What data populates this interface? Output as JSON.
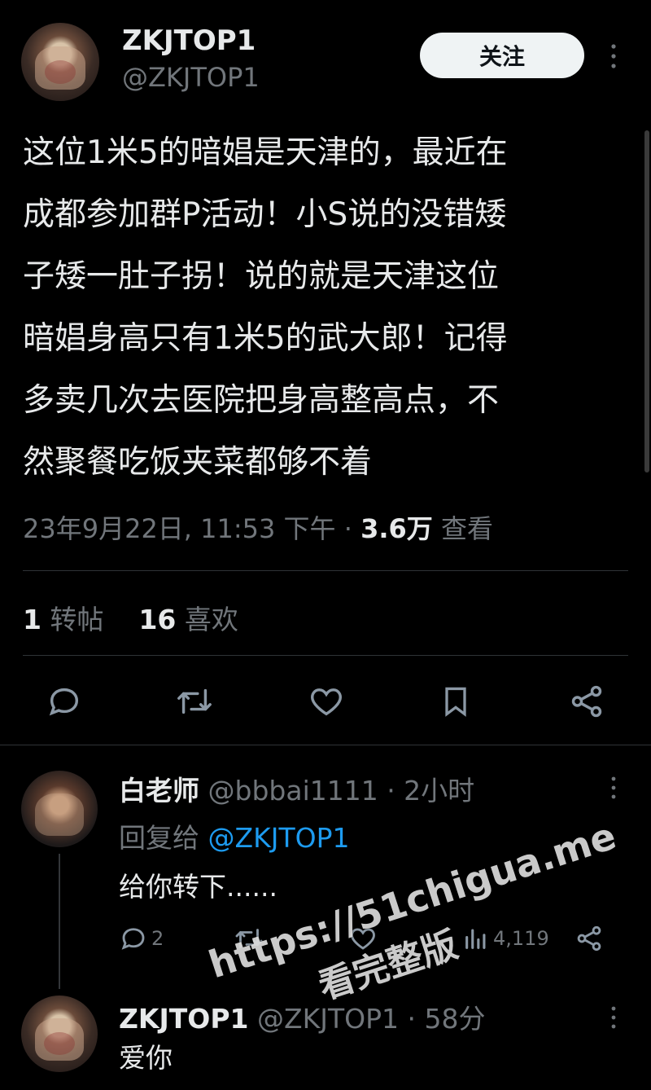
{
  "tweet": {
    "display_name": "ZKJTOP1",
    "handle": "@ZKJTOP1",
    "follow_label": "关注",
    "body_lines": [
      "这位1米5的暗娼是天津的，最近在",
      "成都参加群P活动！小S说的没错矮",
      "子矮一肚子拐！说的就是天津这位",
      "暗娼身高只有1米5的武大郎！记得",
      "多卖几次去医院把身高整高点，不",
      "然聚餐吃饭夹菜都够不着"
    ],
    "timestamp": "23年9月22日, 11:53 下午 · ",
    "views_count": "3.6万",
    "views_label": " 查看",
    "retweets_count": "1",
    "retweets_label": "转帖",
    "likes_count": "16",
    "likes_label": "喜欢"
  },
  "reply1": {
    "display_name": "白老师",
    "meta": "@bbbai1111 · 2小时",
    "replying_prefix": "回复给 ",
    "replying_to": "@ZKJTOP1",
    "text": "给你转下......",
    "reply_count": "2",
    "views_count": "4,119"
  },
  "reply2": {
    "display_name": "ZKJTOP1",
    "meta": "@ZKJTOP1 · 58分",
    "text": "爱你"
  },
  "watermark": {
    "url": "https://51chigua.me",
    "caption": "看完整版"
  },
  "icons": {
    "more": "more-vertical-icon",
    "reply": "reply-icon",
    "retweet": "retweet-icon",
    "like": "heart-icon",
    "bookmark": "bookmark-icon",
    "share": "share-icon",
    "views": "bar-chart-icon"
  },
  "colors": {
    "background": "#000000",
    "text": "#e7e9ea",
    "muted": "#71767b",
    "link": "#1d9bf0",
    "divider": "#2f3336"
  }
}
